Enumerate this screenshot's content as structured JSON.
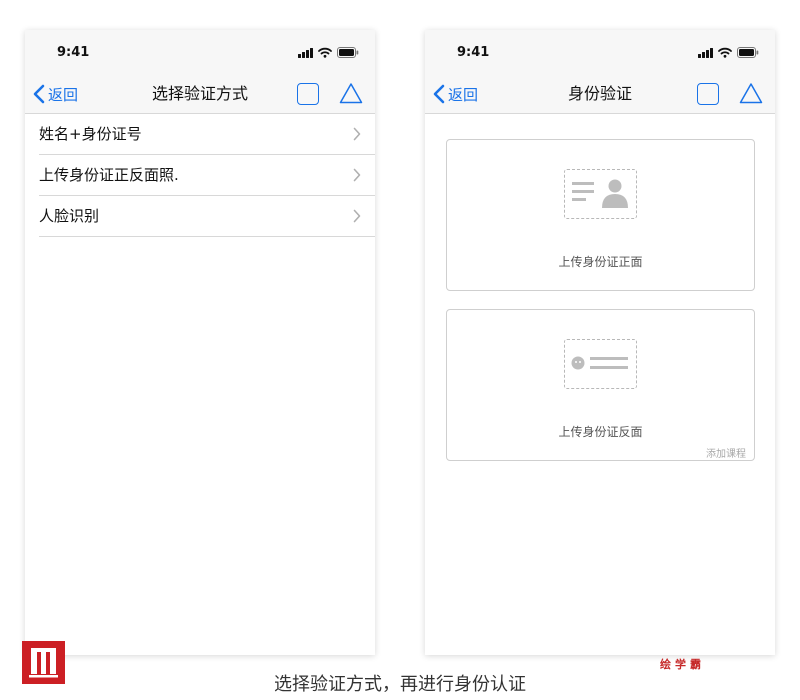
{
  "colors": {
    "accent": "#1a73e8",
    "brand": "#cc1f24",
    "divider": "#d8d8d8",
    "nav_background": "#f7f7f7"
  },
  "left_screen": {
    "status_bar": {
      "time": "9:41",
      "icons": [
        "signal-icon",
        "wifi-icon",
        "battery-icon"
      ]
    },
    "nav": {
      "back_label": "返回",
      "title": "选择验证方式",
      "actions": [
        "square-icon",
        "triangle-icon"
      ]
    },
    "options": [
      {
        "label": "姓名+身份证号"
      },
      {
        "label": "上传身份证正反面照."
      },
      {
        "label": "人脸识别"
      }
    ]
  },
  "right_screen": {
    "status_bar": {
      "time": "9:41",
      "icons": [
        "signal-icon",
        "wifi-icon",
        "battery-icon"
      ]
    },
    "nav": {
      "back_label": "返回",
      "title": "身份验证",
      "actions": [
        "square-icon",
        "triangle-icon"
      ]
    },
    "cards": [
      {
        "label": "上传身份证正面",
        "icon": "id-card-front-icon"
      },
      {
        "label": "上传身份证反面",
        "icon": "id-card-back-icon",
        "footnote": "添加课程"
      }
    ]
  },
  "footer": {
    "caption": "选择验证方式，再进行身份认证",
    "watermark": "绘学霸",
    "logo": "brand-logo"
  }
}
